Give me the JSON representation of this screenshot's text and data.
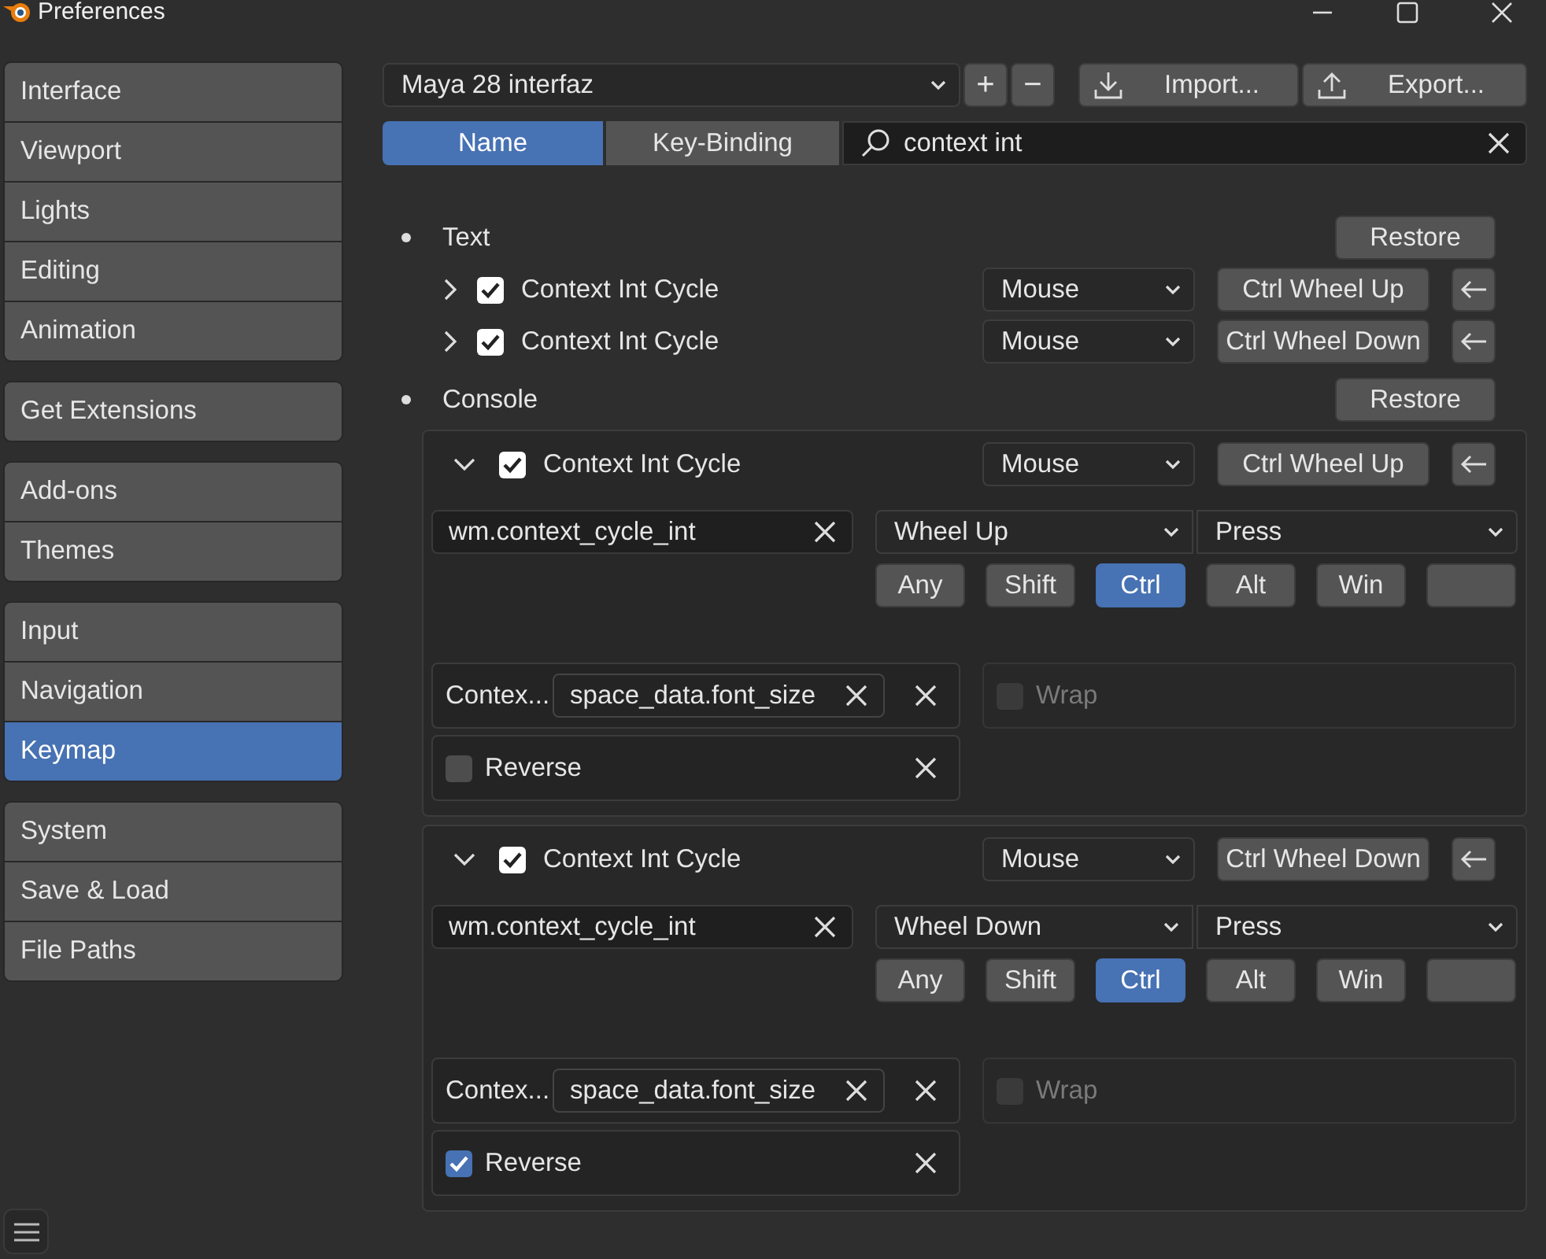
{
  "window": {
    "title": "Preferences"
  },
  "sidebar": {
    "groups": [
      {
        "items": [
          {
            "label": "Interface",
            "selected": false
          },
          {
            "label": "Viewport",
            "selected": false
          },
          {
            "label": "Lights",
            "selected": false
          },
          {
            "label": "Editing",
            "selected": false
          },
          {
            "label": "Animation",
            "selected": false
          }
        ]
      },
      {
        "items": [
          {
            "label": "Get Extensions",
            "selected": false
          }
        ]
      },
      {
        "items": [
          {
            "label": "Add-ons",
            "selected": false
          },
          {
            "label": "Themes",
            "selected": false
          }
        ]
      },
      {
        "items": [
          {
            "label": "Input",
            "selected": false
          },
          {
            "label": "Navigation",
            "selected": false
          },
          {
            "label": "Keymap",
            "selected": true
          }
        ]
      },
      {
        "items": [
          {
            "label": "System",
            "selected": false
          },
          {
            "label": "Save & Load",
            "selected": false
          },
          {
            "label": "File Paths",
            "selected": false
          }
        ]
      }
    ]
  },
  "toolbar": {
    "preset": "Maya 28 interfaz",
    "add": "+",
    "remove": "−",
    "import": "Import...",
    "export": "Export..."
  },
  "tabs": [
    {
      "label": "Name",
      "selected": true
    },
    {
      "label": "Key-Binding",
      "selected": false
    }
  ],
  "search": {
    "value": "context int"
  },
  "sections": [
    {
      "title": "Text",
      "restore": "Restore",
      "items": [
        {
          "expanded": false,
          "enabled": true,
          "name": "Context Int Cycle",
          "input_type": "Mouse",
          "key": "Ctrl Wheel Up"
        },
        {
          "expanded": false,
          "enabled": true,
          "name": "Context Int Cycle",
          "input_type": "Mouse",
          "key": "Ctrl Wheel Down"
        }
      ]
    },
    {
      "title": "Console",
      "restore": "Restore",
      "items": [
        {
          "expanded": true,
          "enabled": true,
          "name": "Context Int Cycle",
          "input_type": "Mouse",
          "key": "Ctrl Wheel Up",
          "operator": "wm.context_cycle_int",
          "event": "Wheel Up",
          "value": "Press",
          "modifiers": [
            {
              "label": "Any",
              "selected": false
            },
            {
              "label": "Shift",
              "selected": false
            },
            {
              "label": "Ctrl",
              "selected": true
            },
            {
              "label": "Alt",
              "selected": false
            },
            {
              "label": "Win",
              "selected": false
            }
          ],
          "properties": [
            {
              "kind": "field",
              "label": "Contex...",
              "value": "space_data.font_size"
            },
            {
              "kind": "checkbox",
              "label": "Wrap",
              "checked": false,
              "disabled": true
            },
            {
              "kind": "checkbox",
              "label": "Reverse",
              "checked": false,
              "disabled": false
            }
          ]
        },
        {
          "expanded": true,
          "enabled": true,
          "name": "Context Int Cycle",
          "input_type": "Mouse",
          "key": "Ctrl Wheel Down",
          "operator": "wm.context_cycle_int",
          "event": "Wheel Down",
          "value": "Press",
          "modifiers": [
            {
              "label": "Any",
              "selected": false
            },
            {
              "label": "Shift",
              "selected": false
            },
            {
              "label": "Ctrl",
              "selected": true
            },
            {
              "label": "Alt",
              "selected": false
            },
            {
              "label": "Win",
              "selected": false
            }
          ],
          "properties": [
            {
              "kind": "field",
              "label": "Contex...",
              "value": "space_data.font_size"
            },
            {
              "kind": "checkbox",
              "label": "Wrap",
              "checked": false,
              "disabled": true
            },
            {
              "kind": "checkbox",
              "label": "Reverse",
              "checked": true,
              "disabled": false
            }
          ]
        }
      ]
    }
  ]
}
